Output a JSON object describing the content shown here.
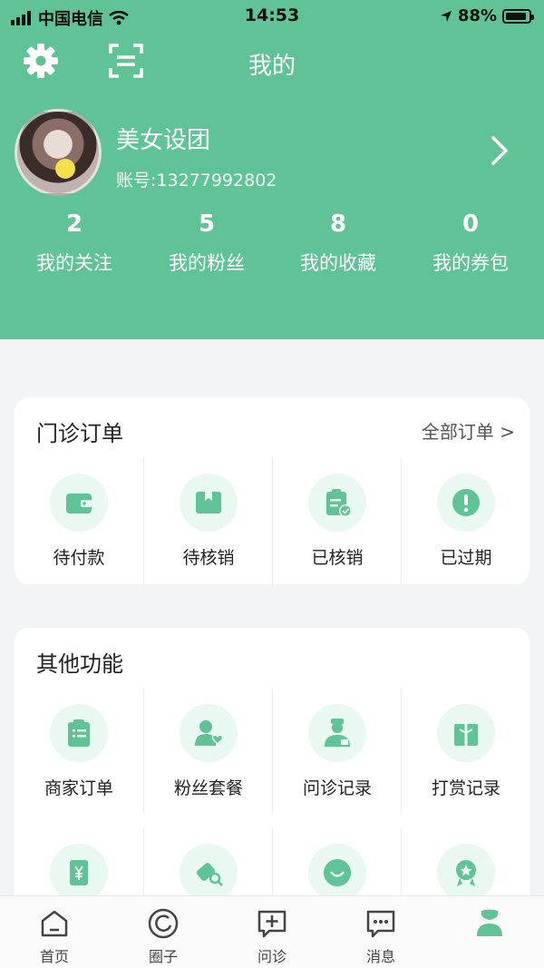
{
  "status_bar": {
    "carrier": "中国电信",
    "time": "14:53",
    "battery": "88%"
  },
  "header": {
    "title": "我的"
  },
  "profile": {
    "name": "美女设团",
    "account": "账号:13277992802"
  },
  "stats": [
    {
      "value": "2",
      "label": "我的关注"
    },
    {
      "value": "5",
      "label": "我的粉丝"
    },
    {
      "value": "8",
      "label": "我的收藏"
    },
    {
      "value": "0",
      "label": "我的券包"
    }
  ],
  "orders": {
    "title": "门诊订单",
    "all_link": "全部订单 >",
    "items": [
      {
        "label": "待付款",
        "icon": "wallet-icon"
      },
      {
        "label": "待核销",
        "icon": "box-icon"
      },
      {
        "label": "已核销",
        "icon": "clipboard-check-icon"
      },
      {
        "label": "已过期",
        "icon": "exclamation-icon"
      }
    ]
  },
  "other": {
    "title": "其他功能",
    "items": [
      {
        "label": "商家订单",
        "icon": "clipboard-list-icon"
      },
      {
        "label": "粉丝套餐",
        "icon": "user-heart-icon"
      },
      {
        "label": "问诊记录",
        "icon": "doctor-icon"
      },
      {
        "label": "打赏记录",
        "icon": "gift-icon"
      },
      {
        "label": "",
        "icon": "yen-card-icon"
      },
      {
        "label": "",
        "icon": "search-ticket-icon"
      },
      {
        "label": "",
        "icon": "chat-smile-icon"
      },
      {
        "label": "",
        "icon": "award-icon"
      }
    ]
  },
  "tabbar": [
    {
      "label": "首页",
      "icon": "home-icon"
    },
    {
      "label": "圈子",
      "icon": "circle-icon"
    },
    {
      "label": "问诊",
      "icon": "plus-chat-icon"
    },
    {
      "label": "消息",
      "icon": "message-icon"
    },
    {
      "label": "",
      "icon": "profile-icon",
      "active": true
    }
  ],
  "colors": {
    "primary": "#5fc396",
    "icon_bg": "#e9f8f0",
    "page_bg": "#f3f4f6"
  }
}
